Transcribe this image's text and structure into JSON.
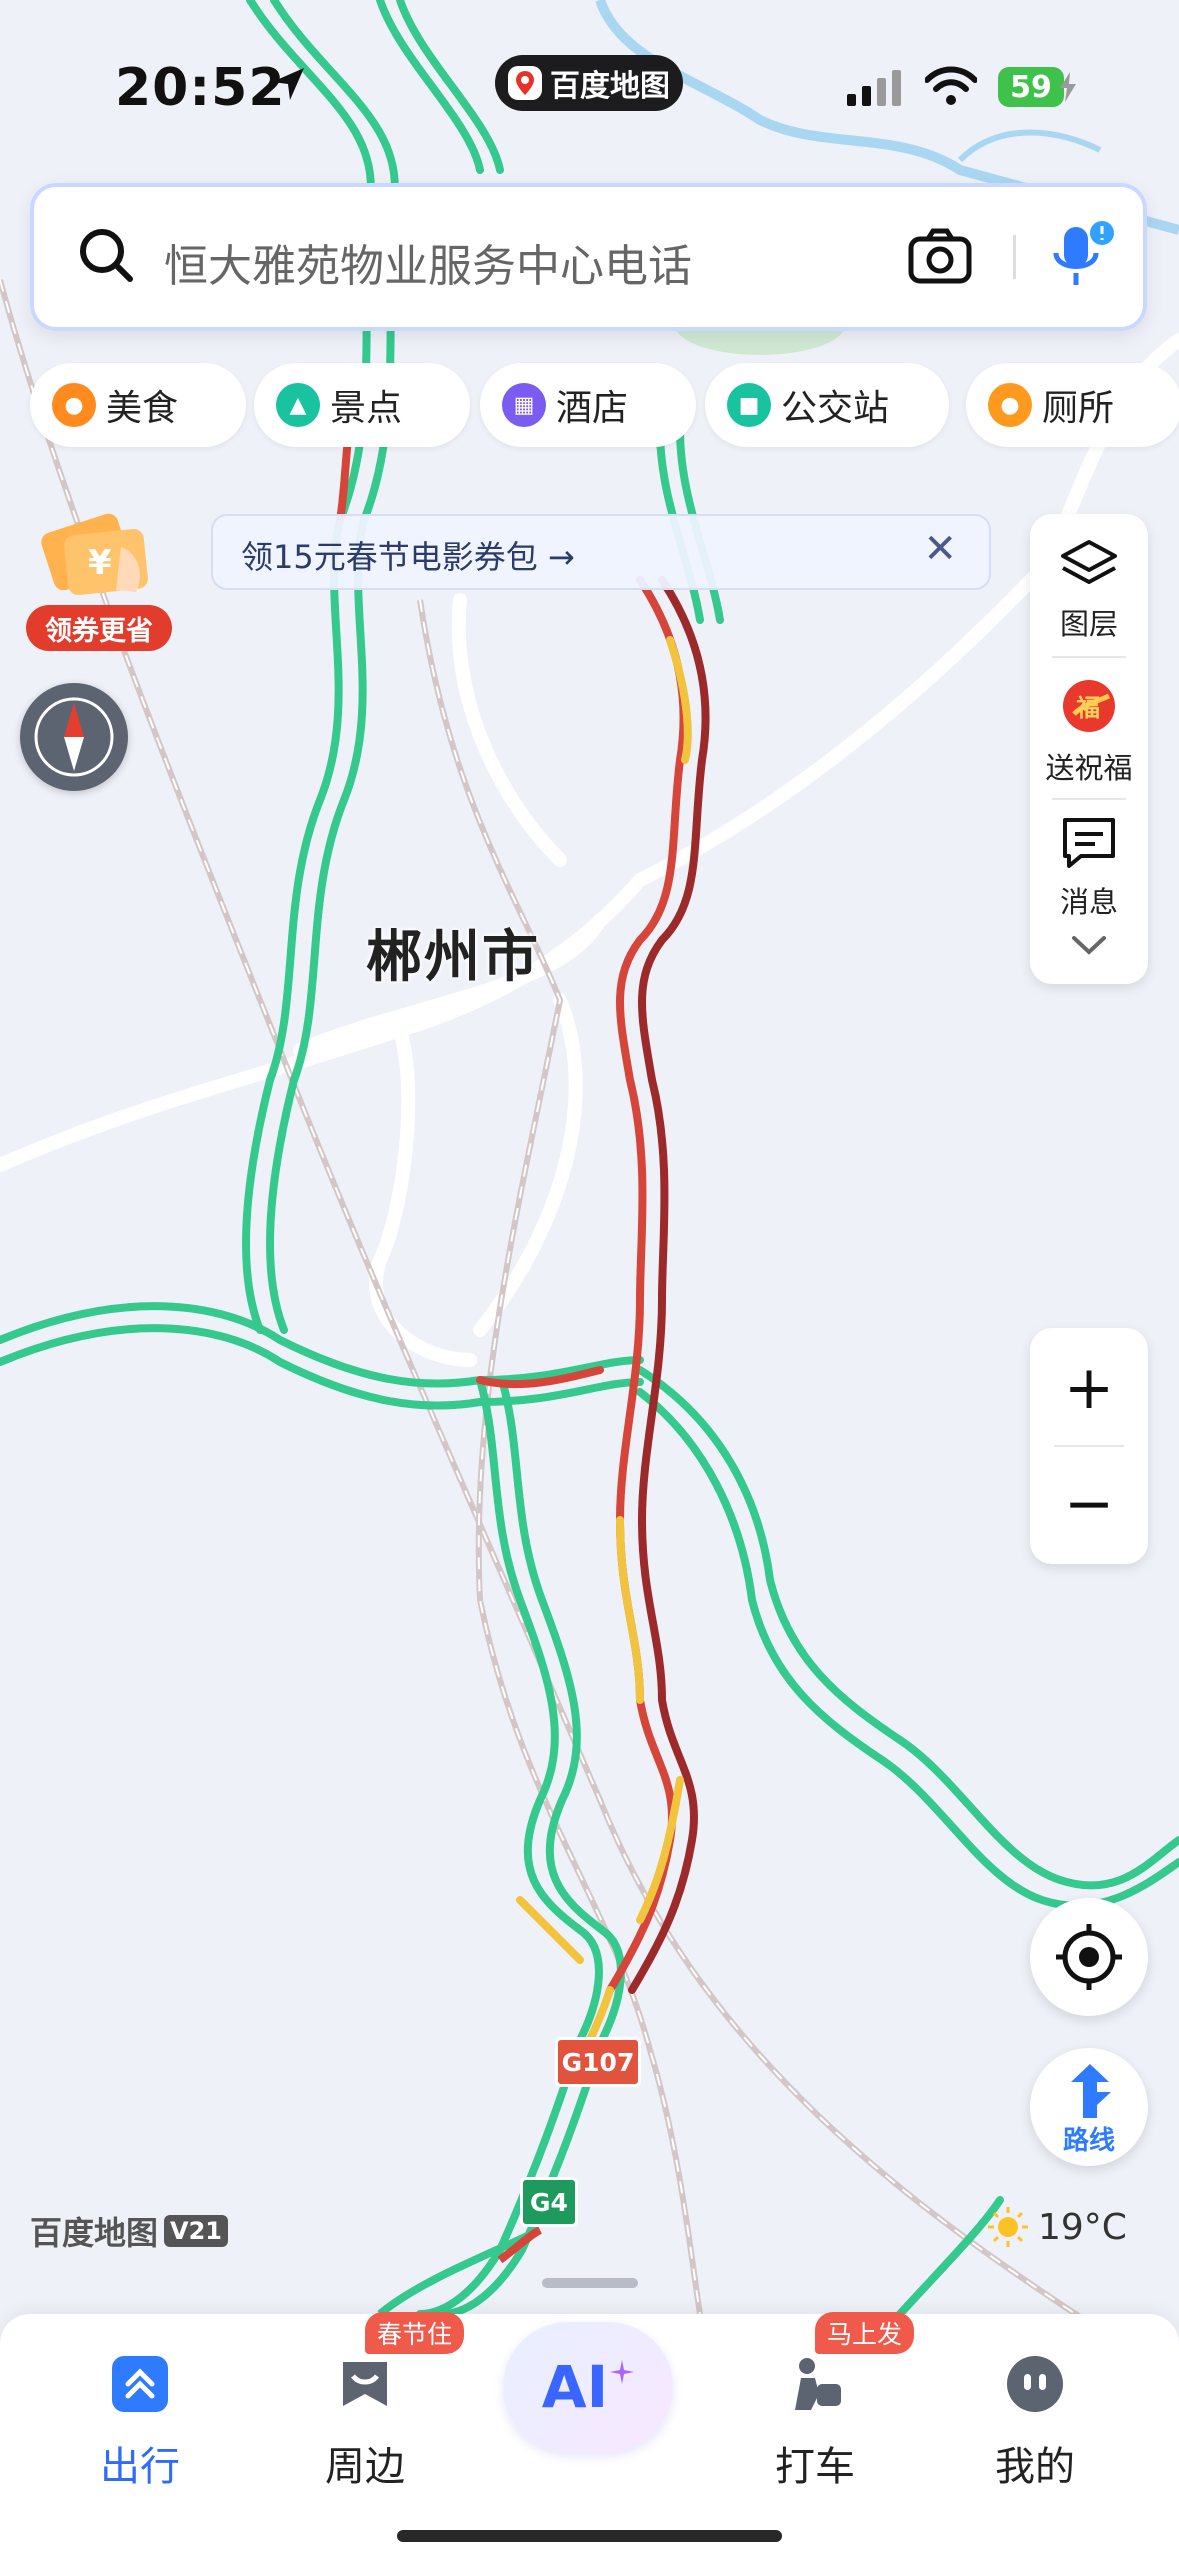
{
  "status_bar": {
    "time": "20:52",
    "app_name": "百度地图",
    "battery": "59"
  },
  "search": {
    "placeholder": "恒大雅苑物业服务中心电话"
  },
  "categories": [
    {
      "label": "美食",
      "color": "#ff8a1f",
      "icon": "food-icon"
    },
    {
      "label": "景点",
      "color": "#19c3a0",
      "icon": "scenic-icon"
    },
    {
      "label": "酒店",
      "color": "#7a5cf0",
      "icon": "hotel-icon"
    },
    {
      "label": "公交站",
      "color": "#19c3a0",
      "icon": "bus-icon"
    },
    {
      "label": "厕所",
      "color": "#ff9a1f",
      "icon": "toilet-icon"
    }
  ],
  "banner": {
    "text": "领15元春节电影券包 →",
    "close": "✕"
  },
  "coupon": {
    "label": "领券更省"
  },
  "right_panel": {
    "layers": "图层",
    "greetings": "送祝福",
    "messages": "消息"
  },
  "zoom": {
    "plus": "+",
    "minus": "−"
  },
  "route_button": {
    "label": "路线"
  },
  "map": {
    "city_label": "郴州市",
    "road_shields": [
      {
        "label": "G107",
        "color": "#e2533e"
      },
      {
        "label": "G4",
        "color": "#1e9b5c"
      }
    ],
    "colors": {
      "background": "#eef1f8",
      "road_clear": "#35c98e",
      "road_slow": "#f2c43d",
      "road_jam": "#d6453a",
      "road_severe": "#9c2a2a",
      "railway": "#c9b8b8"
    }
  },
  "watermark": {
    "brand": "百度地图",
    "version": "V21"
  },
  "weather": {
    "temp": "19°C"
  },
  "bottom_nav": [
    {
      "label": "出行",
      "active": true,
      "icon": "travel-icon"
    },
    {
      "label": "周边",
      "badge": "春节住",
      "icon": "nearby-icon"
    },
    {
      "label": "AI",
      "icon": "ai-icon"
    },
    {
      "label": "打车",
      "badge": "马上发",
      "icon": "taxi-icon"
    },
    {
      "label": "我的",
      "icon": "profile-icon"
    }
  ]
}
